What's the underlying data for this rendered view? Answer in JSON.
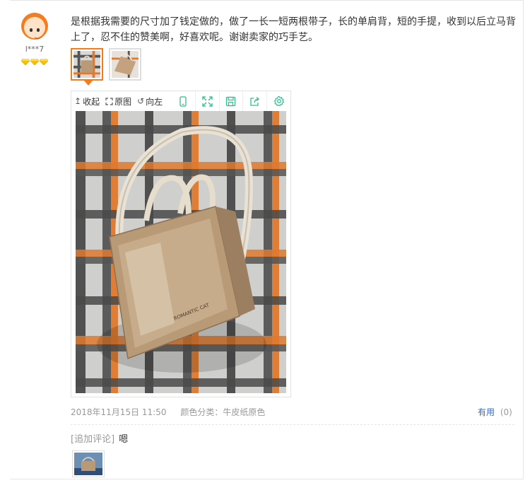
{
  "user": {
    "name": "l***7",
    "avatar_icon": "cartoon-avatar-icon",
    "rank_icon": "diamond-icon",
    "rank_count": 3,
    "accent": "#f57d21"
  },
  "review": {
    "text": "是根据我需要的尺寸加了钱定做的，做了一长一短两根带子，长的单肩背，短的手提，收到以后立马背上了，忍不住的赞美啊，好喜欢呢。谢谢卖家的巧手艺。"
  },
  "thumbnails": [
    {
      "name": "tote-bag-photo-1",
      "selected": true
    },
    {
      "name": "tote-bag-photo-2",
      "selected": false
    }
  ],
  "viewer": {
    "collapse_label": "收起",
    "original_label": "原图",
    "rotate_label": "向左",
    "icons": [
      "phone-icon",
      "fullscreen-icon",
      "save-icon",
      "share-icon",
      "settings-icon"
    ],
    "icon_color": "#2fbf8f",
    "photo_subject": "kraft-paper-tote-bag-on-plaid-fabric",
    "bag_print": "ROMANTIC CAT"
  },
  "meta": {
    "date": "2018年11月15日 11:50",
    "color_category": "颜色分类：牛皮纸原色"
  },
  "useful": {
    "label": "有用",
    "count": "(0)",
    "color": "#3366cc"
  },
  "followup": {
    "tag": "[追加评论]",
    "text": "嗯"
  }
}
